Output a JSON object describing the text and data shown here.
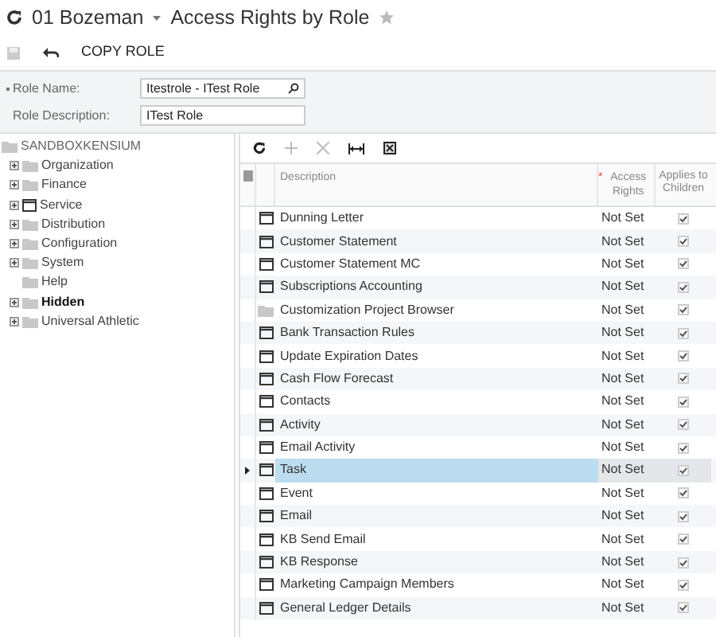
{
  "header": {
    "company": "01 Bozeman",
    "title": "Access Rights by Role",
    "favorite": false
  },
  "toolbar": {
    "copy_label": "COPY ROLE"
  },
  "form": {
    "role_name_label": "Role Name:",
    "role_name": "Itestrole - ITest Role",
    "role_description_label": "Role Description:",
    "role_description": "ITest Role"
  },
  "tree": {
    "label": "SANDBOXKENSIUM",
    "children": [
      {
        "label": "Organization",
        "kind": "folder",
        "expandable": true,
        "bold": false
      },
      {
        "label": "Finance",
        "kind": "folder",
        "expandable": true,
        "bold": false
      },
      {
        "label": "Service",
        "kind": "screen",
        "expandable": true,
        "bold": false
      },
      {
        "label": "Distribution",
        "kind": "folder",
        "expandable": true,
        "bold": false
      },
      {
        "label": "Configuration",
        "kind": "folder",
        "expandable": true,
        "bold": false
      },
      {
        "label": "System",
        "kind": "folder",
        "expandable": true,
        "bold": false
      },
      {
        "label": "Help",
        "kind": "folder",
        "expandable": false,
        "bold": false
      },
      {
        "label": "Hidden",
        "kind": "folder",
        "expandable": true,
        "bold": true
      },
      {
        "label": "Universal Athletic",
        "kind": "folder",
        "expandable": true,
        "bold": false
      }
    ]
  },
  "grid": {
    "columns": [
      "Description",
      "Access Rights",
      "Applies to Children"
    ],
    "required_mark": "*",
    "rows": [
      {
        "description": "Dunning Letter",
        "kind": "screen",
        "access": "Not Set",
        "applies": true,
        "selected": false
      },
      {
        "description": "Customer Statement",
        "kind": "screen",
        "access": "Not Set",
        "applies": true,
        "selected": false
      },
      {
        "description": "Customer Statement MC",
        "kind": "screen",
        "access": "Not Set",
        "applies": true,
        "selected": false
      },
      {
        "description": "Subscriptions Accounting",
        "kind": "screen",
        "access": "Not Set",
        "applies": true,
        "selected": false
      },
      {
        "description": "Customization Project Browser",
        "kind": "folder",
        "access": "Not Set",
        "applies": true,
        "selected": false
      },
      {
        "description": "Bank Transaction Rules",
        "kind": "screen",
        "access": "Not Set",
        "applies": true,
        "selected": false
      },
      {
        "description": "Update Expiration Dates",
        "kind": "screen",
        "access": "Not Set",
        "applies": true,
        "selected": false
      },
      {
        "description": "Cash Flow Forecast",
        "kind": "screen",
        "access": "Not Set",
        "applies": true,
        "selected": false
      },
      {
        "description": "Contacts",
        "kind": "screen",
        "access": "Not Set",
        "applies": true,
        "selected": false
      },
      {
        "description": "Activity",
        "kind": "screen",
        "access": "Not Set",
        "applies": true,
        "selected": false
      },
      {
        "description": "Email Activity",
        "kind": "screen",
        "access": "Not Set",
        "applies": true,
        "selected": false
      },
      {
        "description": "Task",
        "kind": "screen",
        "access": "Not Set",
        "applies": true,
        "selected": true
      },
      {
        "description": "Event",
        "kind": "screen",
        "access": "Not Set",
        "applies": true,
        "selected": false
      },
      {
        "description": "Email",
        "kind": "screen",
        "access": "Not Set",
        "applies": true,
        "selected": false
      },
      {
        "description": "KB Send Email",
        "kind": "screen",
        "access": "Not Set",
        "applies": true,
        "selected": false
      },
      {
        "description": "KB Response",
        "kind": "screen",
        "access": "Not Set",
        "applies": true,
        "selected": false
      },
      {
        "description": "Marketing Campaign Members",
        "kind": "screen",
        "access": "Not Set",
        "applies": true,
        "selected": false
      },
      {
        "description": "General Ledger Details",
        "kind": "screen",
        "access": "Not Set",
        "applies": true,
        "selected": false
      }
    ]
  }
}
